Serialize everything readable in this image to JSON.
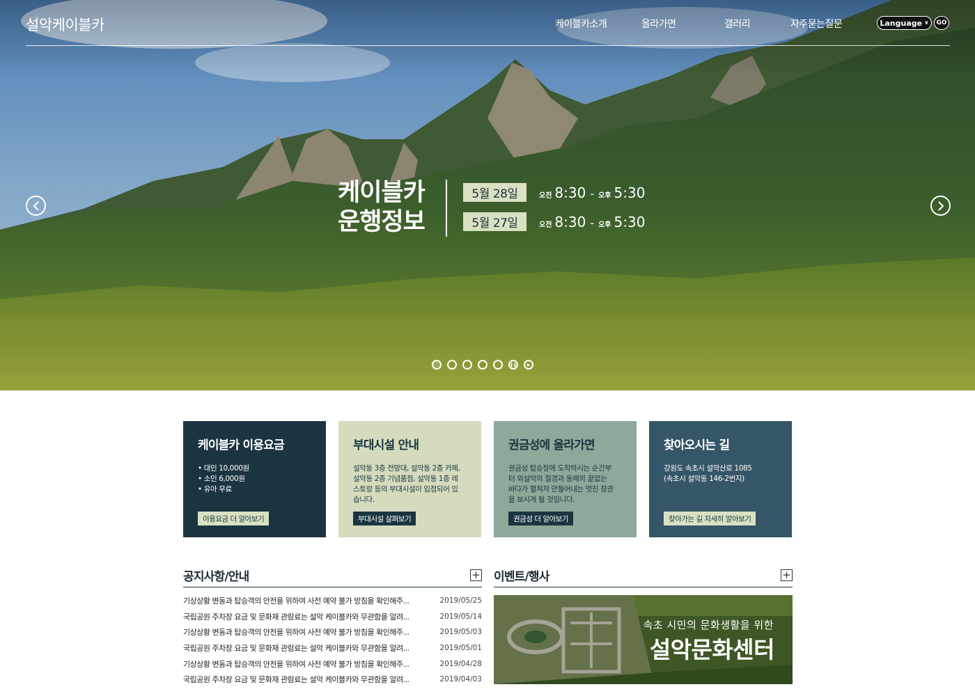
{
  "header": {
    "logo": "설악케이블카",
    "menu": [
      "케이블카소개",
      "올라가면",
      "갤러리",
      "자주묻는질문"
    ],
    "language_label": "Language",
    "go_label": "GO"
  },
  "hero": {
    "title_line1": "케이블카",
    "title_line2": "운행정보",
    "schedule": [
      {
        "date": "5월 28일",
        "start_ampm": "오전",
        "start": "8:30",
        "sep": "-",
        "end_ampm": "오후",
        "end": "5:30"
      },
      {
        "date": "5월 27일",
        "start_ampm": "오전",
        "start": "8:30",
        "sep": "-",
        "end_ampm": "오후",
        "end": "5:30"
      }
    ],
    "slide_count": 5,
    "active_slide": 1
  },
  "cards": [
    {
      "title": "케이블카 이용요금",
      "lines": [
        "• 대인 10,000원",
        "• 소인 6,000원",
        "• 유아 무료"
      ],
      "button": "이용요금 더 알아보기"
    },
    {
      "title": "부대시설 안내",
      "lines": [
        "설악동 3층 전망대, 설악동 2층 카페,",
        "설악동 2층 기념품점, 설악동 1층 레",
        "스토랑 등의 부대시설이 입점되어 있",
        "습니다."
      ],
      "button": "부대시설 살펴보기"
    },
    {
      "title": "권금성에 올라가면",
      "lines": [
        "권금성 탑승장에 도착하시는 순간부",
        "터 외설악의 절경과 동해의 끝없는",
        "바다가 펼쳐져 만들어내는 멋진 장관",
        "을 보시게 될 것입니다."
      ],
      "button": "권금성 더 알아보기"
    },
    {
      "title": "찾아오시는 길",
      "lines": [
        "강원도 속초시 설악산로 1085",
        "(속초시 설악동 146-2번지)"
      ],
      "button": "찾아가는 길 자세히 알아보기"
    }
  ],
  "notices": {
    "title": "공지사항/안내",
    "more": "+",
    "items": [
      {
        "text": "기상상황 변동과 탑승객의 안전을 위하여 사전 예약 불가 방침을 확인해주...",
        "date": "2019/05/25"
      },
      {
        "text": "국립공원 주차장 요금 및 문화재 관람료는 설악 케이블카와 무관함을 알려...",
        "date": "2019/05/14"
      },
      {
        "text": "기상상황 변동과 탑승객의 안전을 위하여 사전 예약 불가 방침을 확인해주...",
        "date": "2019/05/03"
      },
      {
        "text": "국립공원 주차장 요금 및 문화재 관람료는 설악 케이블카와 무관함을 알려...",
        "date": "2019/05/01"
      },
      {
        "text": "기상상황 변동과 탑승객의 안전을 위하여 사전 예약 불가 방침을 확인해주...",
        "date": "2019/04/28"
      },
      {
        "text": "국립공원 주차장 요금 및 문화재 관람료는 설악 케이블카와 무관함을 알려...",
        "date": "2019/04/03"
      }
    ]
  },
  "events": {
    "title": "이벤트/행사",
    "more": "+",
    "banner_subtitle": "속초 시민의 문화생활을 위한",
    "banner_title": "설악문화센터"
  },
  "colors": {
    "navy": "#1b3540",
    "sage_light": "#d4dcbd",
    "sage": "#8ea89a",
    "slate": "#355668",
    "chip": "#d8e2c3"
  }
}
